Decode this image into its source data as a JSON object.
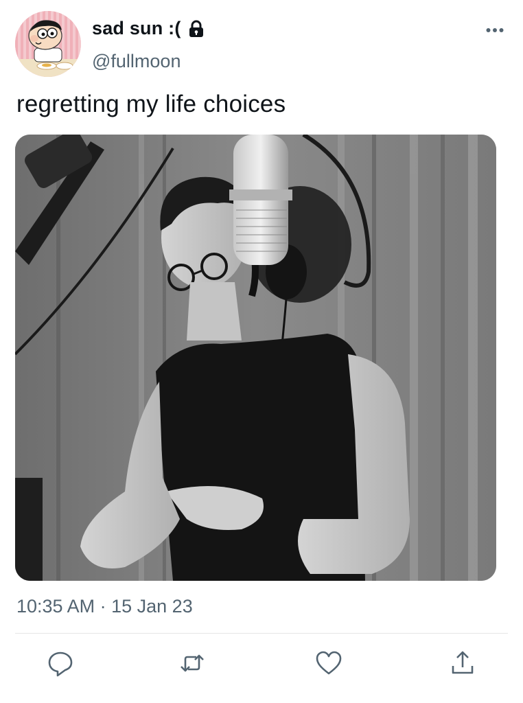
{
  "tweet": {
    "author": {
      "display_name": "sad sun :(",
      "handle": "@fullmoon",
      "protected_icon": "lock-icon",
      "avatar": "cartoon-boy-avatar"
    },
    "more_icon": "ellipsis-icon",
    "text": "regretting my life choices",
    "media": {
      "kind": "photo",
      "subject": "person-at-studio-microphone"
    },
    "time": "10:35 AM",
    "separator": "·",
    "date": "15 Jan 23",
    "actions": [
      {
        "name": "reply",
        "icon": "reply-icon"
      },
      {
        "name": "retweet",
        "icon": "retweet-icon"
      },
      {
        "name": "like",
        "icon": "heart-icon"
      },
      {
        "name": "share",
        "icon": "share-icon"
      }
    ]
  },
  "colors": {
    "text_primary": "#0f1419",
    "text_secondary": "#536471",
    "divider": "#e6e6e6"
  }
}
